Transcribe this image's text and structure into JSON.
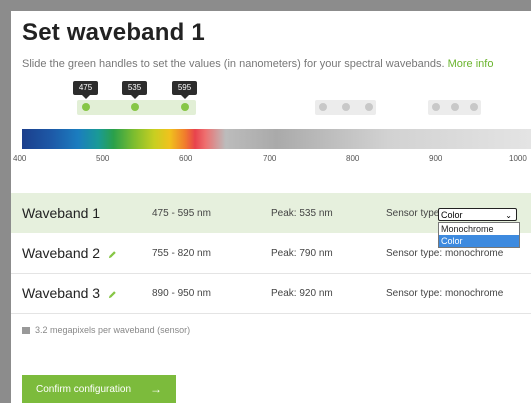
{
  "page": {
    "title": "Set waveband 1",
    "subtitle": "Slide the green handles to set the values (in nanometers) for your spectral wavebands.",
    "more_info": "More info"
  },
  "slider": {
    "labels": [
      "475",
      "535",
      "595"
    ],
    "ticks": [
      "400",
      "500",
      "600",
      "700",
      "800",
      "900",
      "1000"
    ],
    "accent_color": "#86c645"
  },
  "wavebands": [
    {
      "name": "Waveband 1",
      "range": "475 - 595 nm",
      "peak": "Peak: 535 nm",
      "sensor_label": "Sensor type:",
      "sensor_value": "Color"
    },
    {
      "name": "Waveband 2",
      "range": "755 - 820 nm",
      "peak": "Peak: 790 nm",
      "sensor_label": "Sensor type:",
      "sensor_value": "monochrome"
    },
    {
      "name": "Waveband 3",
      "range": "890 - 950 nm",
      "peak": "Peak: 920 nm",
      "sensor_label": "Sensor type:",
      "sensor_value": "monochrome"
    }
  ],
  "dropdown": {
    "options": [
      "Monochrome",
      "Color"
    ],
    "highlighted": "Color"
  },
  "info_text": "3.2 megapixels per waveband (sensor)",
  "confirm": {
    "label": "Confirm configuration",
    "arrow": "→"
  },
  "icons": {
    "edit": "pencil-icon",
    "info": "image-icon",
    "select": "chevron-down-icon"
  }
}
